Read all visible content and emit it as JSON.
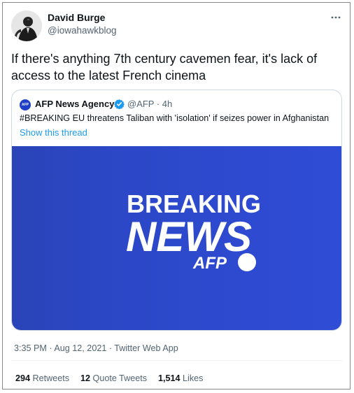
{
  "author": {
    "name": "David Burge",
    "handle": "@iowahawkblog"
  },
  "tweet": {
    "text": "If there's anything 7th century cavemen fear, it's lack of access to the latest French cinema"
  },
  "quoted": {
    "avatar_text": "AFP",
    "name": "AFP News Agency",
    "handle_time": "@AFP · 4h",
    "text": "#BREAKING EU threatens Taliban with 'isolation' if seizes power in Afghanistan",
    "show_thread": "Show this thread",
    "media": {
      "line1": "BREAKING",
      "line2": "NEWS",
      "logo": "AFP",
      "bg_color": "#2e4ad0"
    }
  },
  "meta": "3:35 PM · Aug 12, 2021 · Twitter Web App",
  "stats": {
    "retweets_count": "294",
    "retweets_label": "Retweets",
    "quotes_count": "12",
    "quotes_label": "Quote Tweets",
    "likes_count": "1,514",
    "likes_label": "Likes"
  },
  "colors": {
    "link": "#1d9bf0",
    "verified": "#1d9bf0",
    "secondary_text": "#536471"
  },
  "icons": [
    "more-icon",
    "verified-icon"
  ]
}
